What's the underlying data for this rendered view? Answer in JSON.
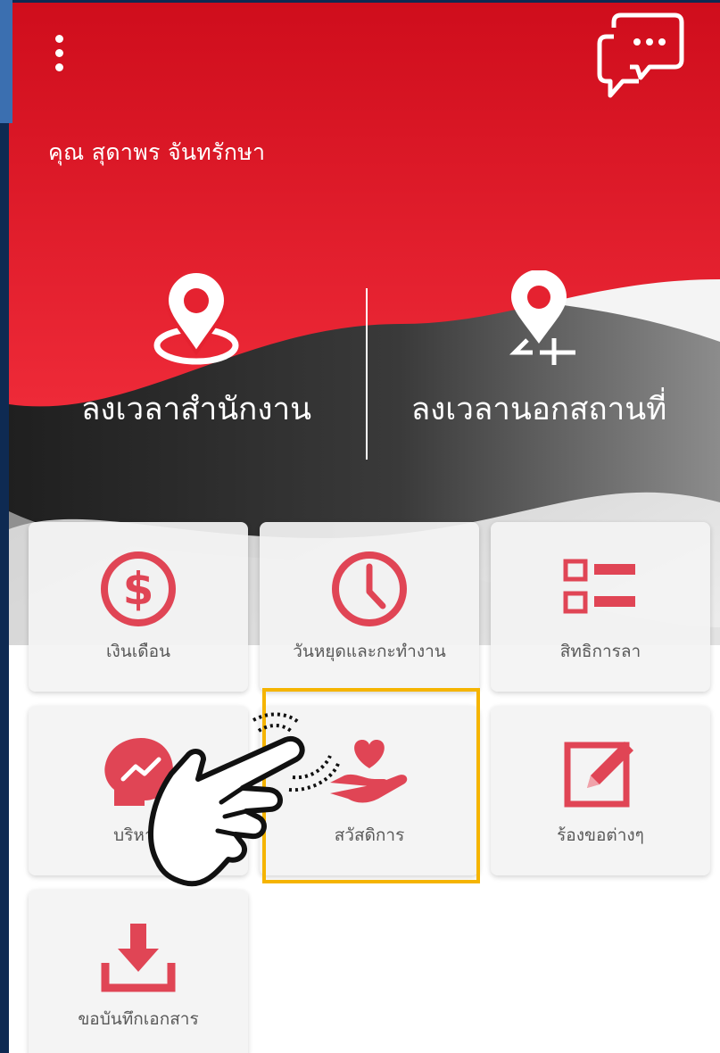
{
  "header": {
    "user_name": "คุณ สุดาพร จันทรักษา",
    "menu_icon": "vertical-dots-icon",
    "chat_icon": "chat-bubbles-icon"
  },
  "checkin": {
    "office_label": "ลงเวลาสำนักงาน",
    "outside_label": "ลงเวลานอกสถานที่"
  },
  "tiles": [
    {
      "label": "เงินเดือน",
      "icon": "dollar-icon"
    },
    {
      "label": "วันหยุดและกะทำงาน",
      "icon": "clock-icon"
    },
    {
      "label": "สิทธิการลา",
      "icon": "list-icon"
    },
    {
      "label": "บริหาร",
      "icon": "head-growth-icon"
    },
    {
      "label": "สวัสดิการ",
      "icon": "heart-hand-icon"
    },
    {
      "label": "ร้องขอต่างๆ",
      "icon": "edit-icon"
    },
    {
      "label": "ขอบันทึกเอกสาร",
      "icon": "download-icon"
    }
  ],
  "colors": {
    "brand_red": "#e52230",
    "icon_red": "#e04555",
    "highlight": "#f5b400",
    "frame": "#0e2a52"
  },
  "overlay": {
    "pointer": "tapping-hand-icon",
    "highlighted_tile": "สวัสดิการ"
  }
}
